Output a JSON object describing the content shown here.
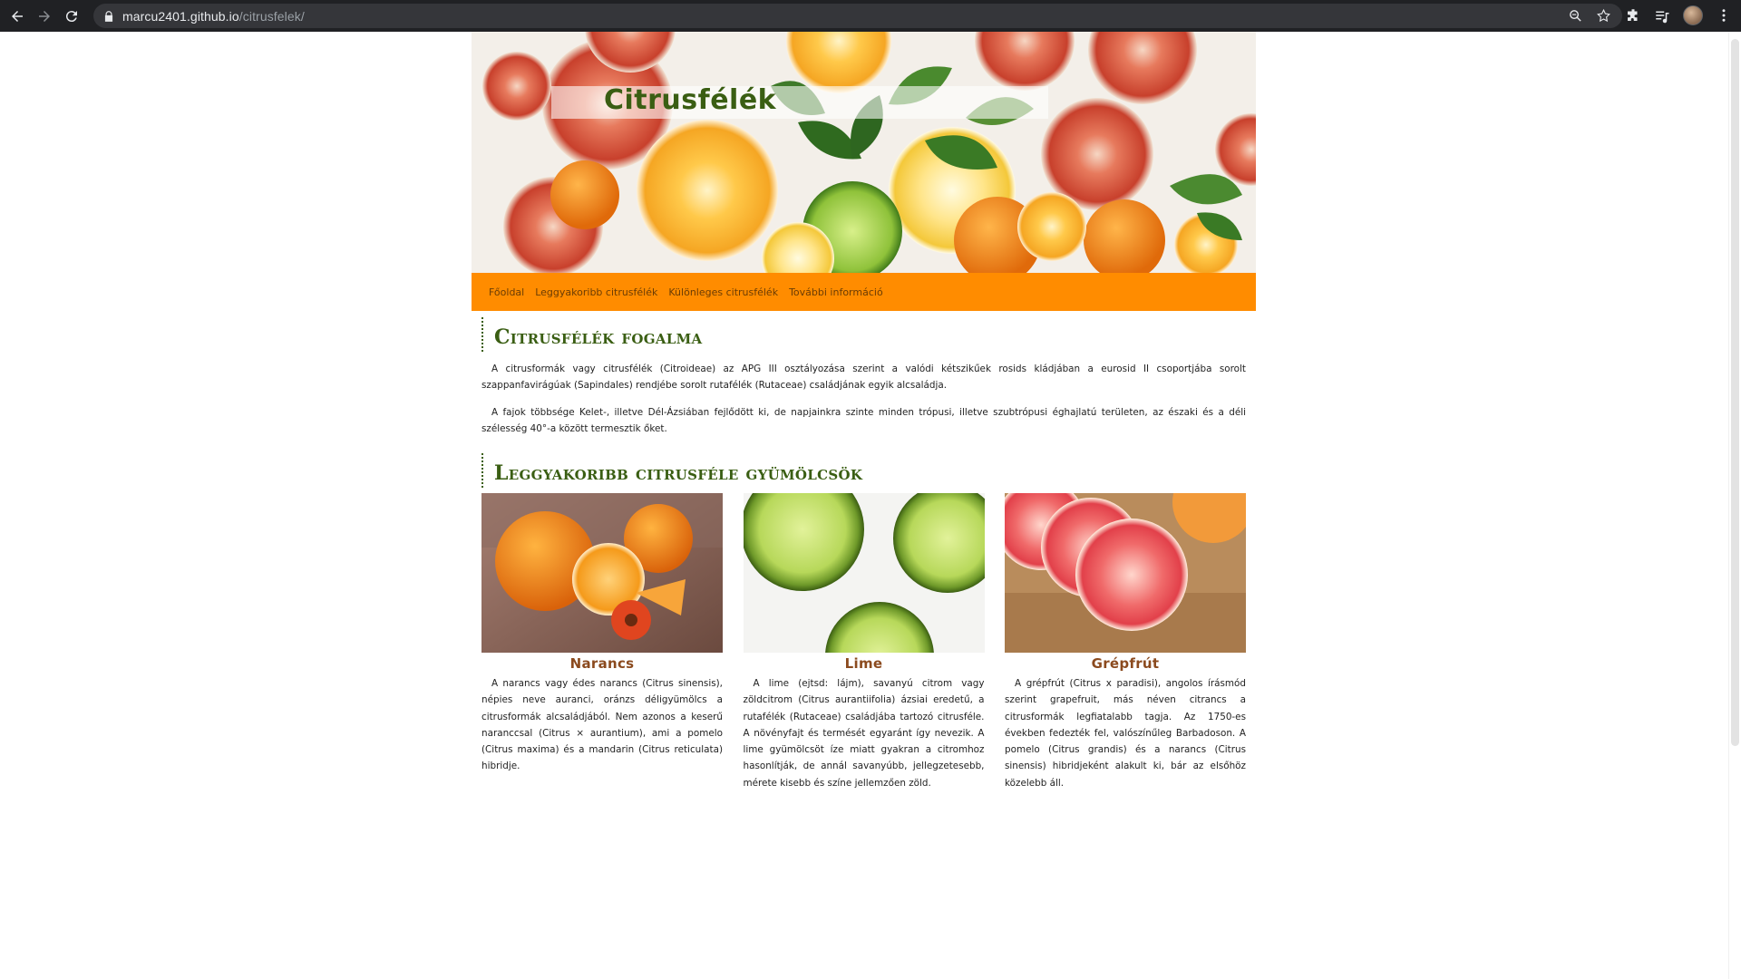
{
  "browser": {
    "url_host": "marcu2401.github.io",
    "url_path": "/citrusfelek/"
  },
  "site": {
    "title": "Citrusfélék",
    "nav": [
      "Főoldal",
      "Leggyakoribb citrusfélék",
      "Különleges citrusfélék",
      "További információ"
    ]
  },
  "sections": {
    "definition": {
      "heading": "Citrusfélék fogalma",
      "paragraphs": [
        "A citrusformák vagy citrusfélék (Citroideae) az APG III osztályozása szerint a valódi kétszikűek rosids kládjában a eurosid II csoportjába sorolt szappanfavirágúak (Sapindales) rendjébe sorolt rutafélék (Rutaceae) családjának egyik alcsaládja.",
        "A fajok többsége Kelet-, illetve Dél-Ázsiában fejlődött ki, de napjainkra szinte minden trópusi, illetve szubtrópusi éghajlatú területen, az északi és a déli szélesség 40°-a között termesztik őket."
      ]
    },
    "common": {
      "heading": "Leggyakoribb citrusféle gyümölcsök",
      "fruits": [
        {
          "name": "Narancs",
          "text": "A narancs vagy édes narancs (Citrus sinensis), népies neve auranci, oránzs déligyümölcs a citrusformák alcsaládjából. Nem azonos a keserű naranccsal (Citrus × aurantium), ami a pomelo (Citrus maxima) és a mandarin (Citrus reticulata) hibridje."
        },
        {
          "name": "Lime",
          "text": "A lime (ejtsd: lájm), savanyú citrom vagy zöldcitrom (Citrus aurantiifolia) ázsiai eredetű, a rutafélék (Rutaceae) családjába tartozó citrusféle. A növényfajt és termését egyaránt így nevezik. A lime gyümölcsöt íze miatt gyakran a citromhoz hasonlítják, de annál savanyúbb, jellegzetesebb, mérete kisebb és színe jellemzően zöld."
        },
        {
          "name": "Grépfrút",
          "text": "A grépfrút (Citrus x paradisi), angolos írásmód szerint grapefruit, más néven citrancs a citrusformák legfiatalabb tagja. Az 1750-es években fedezték fel, valószínűleg Barbadoson. A pomelo (Citrus grandis) és a narancs (Citrus sinensis) hibridjeként alakult ki, bár az elsőhöz közelebb áll."
        }
      ]
    }
  },
  "colors": {
    "accent_orange": "#ff8c00",
    "heading_green": "#3a5e13",
    "fruit_name_brown": "#8b4a1e"
  }
}
